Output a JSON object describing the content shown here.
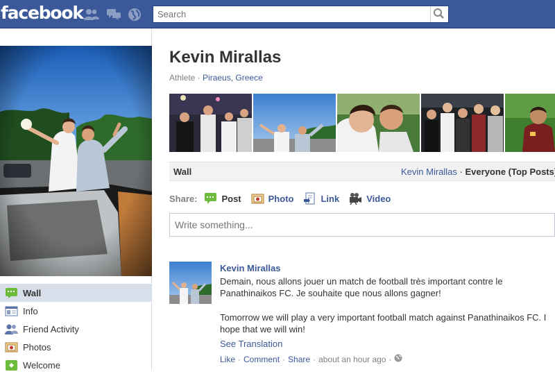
{
  "topbar": {
    "logo": "facebook",
    "icons": [
      "friend-requests-icon",
      "messages-icon",
      "notifications-globe-icon",
      "search-icon"
    ],
    "search": {
      "placeholder": "Search"
    }
  },
  "profile": {
    "name": "Kevin Mirallas",
    "category": "Athlete",
    "separator": "·",
    "location": "Piraeus, Greece"
  },
  "nav": {
    "items": [
      {
        "label": "Wall",
        "icon": "wall-icon",
        "active": true
      },
      {
        "label": "Info",
        "icon": "info-icon"
      },
      {
        "label": "Friend Activity",
        "icon": "friend-activity-icon"
      },
      {
        "label": "Photos",
        "icon": "photos-icon"
      },
      {
        "label": "Welcome",
        "icon": "welcome-icon"
      }
    ]
  },
  "wall": {
    "title": "Wall",
    "filter_name": "Kevin Mirallas",
    "filter_sep": "·",
    "filter_other": "Everyone (Top Posts)"
  },
  "share": {
    "label": "Share:",
    "items": [
      {
        "label": "Post",
        "icon": "status-post-icon"
      },
      {
        "label": "Photo",
        "icon": "photo-icon"
      },
      {
        "label": "Link",
        "icon": "link-icon"
      },
      {
        "label": "Video",
        "icon": "video-camera-icon"
      }
    ],
    "composer_placeholder": "Write something..."
  },
  "post": {
    "author": "Kevin Mirallas",
    "text_fr": "Demain, nous allons jouer un match de football très important contre le Panathinaikos FC. Je souhaite que nous allons gagner!",
    "text_en": "Tomorrow we will play a very important football match against Panathinaikos FC. I hope that we will win!",
    "translate": "See Translation",
    "actions": {
      "like": "Like",
      "comment": "Comment",
      "share": "Share",
      "time": "about an hour ago",
      "sep": "·"
    }
  },
  "colors": {
    "brand": "#3b5998",
    "brand_dark": "#133783",
    "link": "#3b5998",
    "nav_active": "#d8dfea",
    "muted": "#808080",
    "wallbar": "#f2f2f2"
  }
}
